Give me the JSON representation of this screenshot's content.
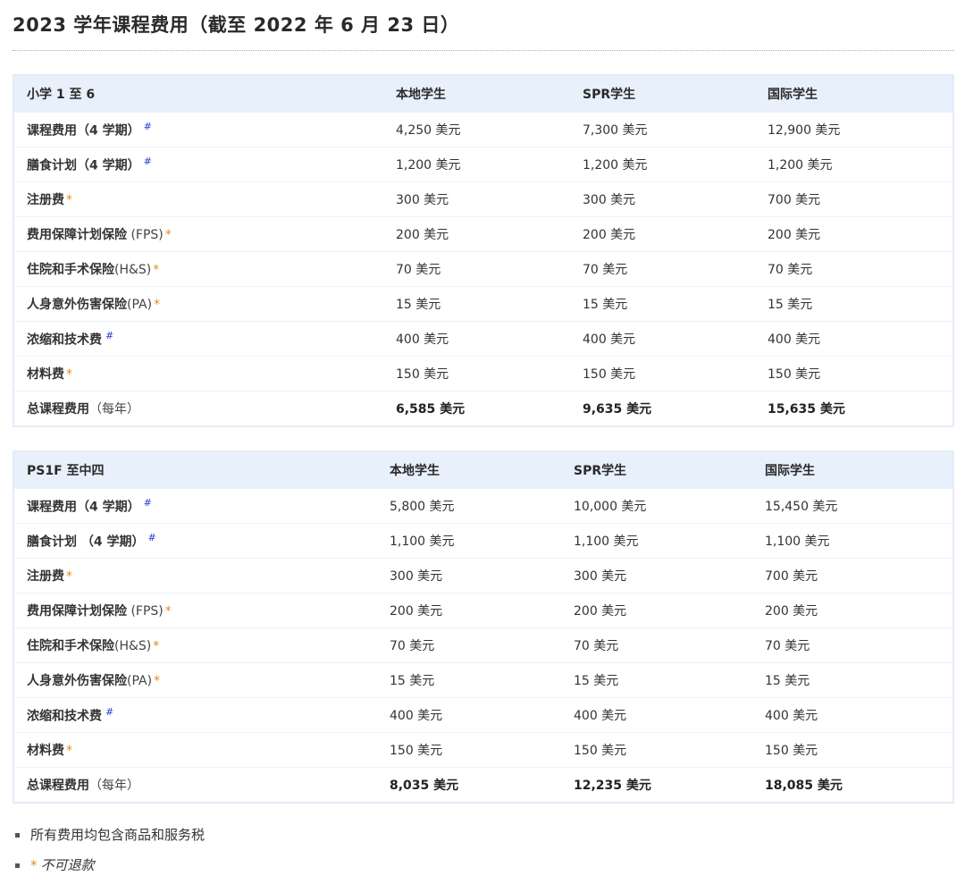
{
  "title": "2023 学年课程费用（截至 2022 年 6 月 23 日）",
  "tables": [
    {
      "header": [
        "小学 1 至 6",
        "本地学生",
        "SPR学生",
        "国际学生"
      ],
      "rows": [
        {
          "label": "课程费用（4 学期）",
          "extra": "",
          "mark": "#",
          "values": [
            "4,250 美元",
            "7,300 美元",
            "12,900 美元"
          ]
        },
        {
          "label": "膳食计划（4 学期）",
          "extra": "",
          "mark": "#",
          "values": [
            "1,200 美元",
            "1,200 美元",
            "1,200 美元"
          ]
        },
        {
          "label": "注册费",
          "extra": "",
          "mark": "*",
          "values": [
            "300 美元",
            "300 美元",
            "700 美元"
          ]
        },
        {
          "label": "费用保障计划保险",
          "extra": " (FPS)",
          "mark": "*",
          "values": [
            "200 美元",
            "200 美元",
            "200 美元"
          ]
        },
        {
          "label": "住院和手术保险",
          "extra": "(H&S)",
          "mark": "*",
          "values": [
            "70 美元",
            "70 美元",
            "70 美元"
          ]
        },
        {
          "label": "人身意外伤害保险",
          "extra": "(PA)",
          "mark": "*",
          "values": [
            "15 美元",
            "15 美元",
            "15 美元"
          ]
        },
        {
          "label": "浓缩和技术费",
          "extra": "",
          "mark": "#",
          "values": [
            "400 美元",
            "400 美元",
            "400 美元"
          ]
        },
        {
          "label": "材料费",
          "extra": "",
          "mark": "*",
          "values": [
            "150 美元",
            "150 美元",
            "150 美元"
          ]
        }
      ],
      "total": {
        "label": "总课程费用",
        "extra": "（每年）",
        "values": [
          "6,585 美元",
          "9,635 美元",
          "15,635 美元"
        ]
      }
    },
    {
      "header": [
        "PS1F 至中四",
        "本地学生",
        "SPR学生",
        "国际学生"
      ],
      "rows": [
        {
          "label": "课程费用（4 学期）",
          "extra": "",
          "mark": "#",
          "values": [
            "5,800 美元",
            "10,000 美元",
            "15,450 美元"
          ]
        },
        {
          "label": "膳食计划 （4 学期）",
          "extra": "",
          "mark": "#",
          "values": [
            "1,100 美元",
            "1,100 美元",
            "1,100 美元"
          ]
        },
        {
          "label": "注册费",
          "extra": "",
          "mark": "*",
          "values": [
            "300 美元",
            "300 美元",
            "700 美元"
          ]
        },
        {
          "label": "费用保障计划保险",
          "extra": " (FPS)",
          "mark": "*",
          "values": [
            "200 美元",
            "200 美元",
            "200 美元"
          ]
        },
        {
          "label": "住院和手术保险",
          "extra": "(H&S)",
          "mark": "*",
          "values": [
            "70 美元",
            "70 美元",
            "70 美元"
          ]
        },
        {
          "label": "人身意外伤害保险",
          "extra": "(PA)",
          "mark": "*",
          "values": [
            "15 美元",
            "15 美元",
            "15 美元"
          ]
        },
        {
          "label": "浓缩和技术费",
          "extra": "",
          "mark": "#",
          "values": [
            "400 美元",
            "400 美元",
            "400 美元"
          ]
        },
        {
          "label": "材料费",
          "extra": "",
          "mark": "*",
          "values": [
            "150 美元",
            "150 美元",
            "150 美元"
          ]
        }
      ],
      "total": {
        "label": "总课程费用",
        "extra": "（每年）",
        "values": [
          "8,035 美元",
          "12,235 美元",
          "18,085 美元"
        ]
      }
    }
  ],
  "notes": [
    {
      "star": "",
      "text": "所有费用均包含商品和服务税",
      "italic": false
    },
    {
      "star": "*",
      "text": "不可退款",
      "italic": true
    }
  ],
  "colors": {
    "hash_mark": "#2a3ad6",
    "star_mark": "#e8872a",
    "header_bg": "#e8f0fb",
    "border": "#e3ebf7"
  }
}
